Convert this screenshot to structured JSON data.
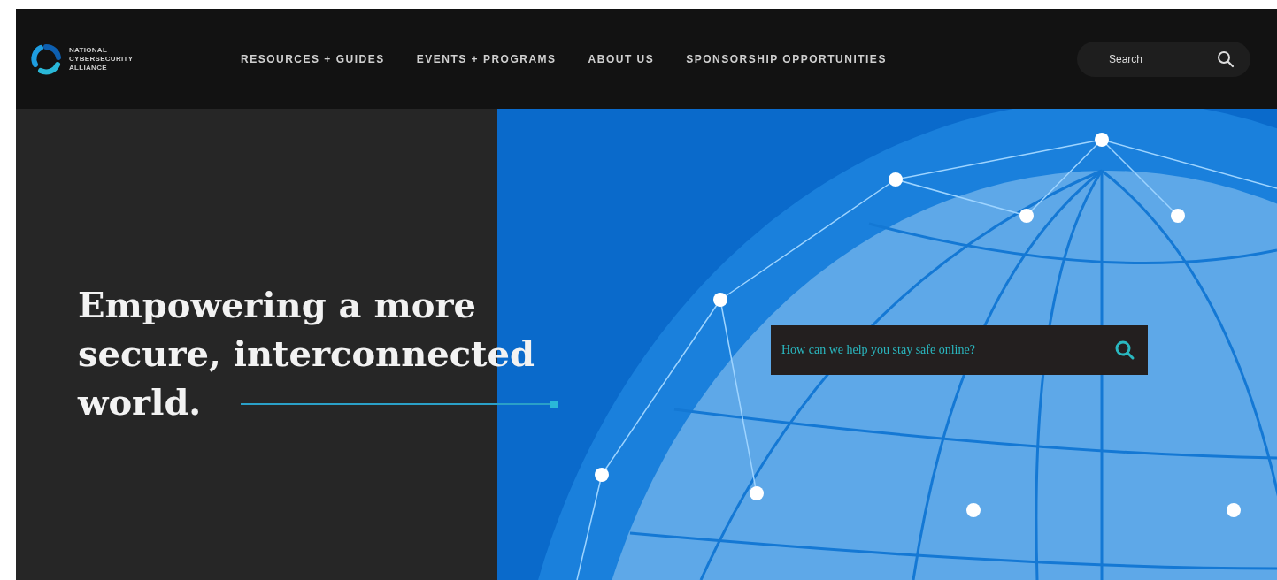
{
  "logo": {
    "lines": [
      "NATIONAL",
      "CYBERSECURITY",
      "ALLIANCE"
    ]
  },
  "nav": {
    "items": [
      {
        "label": "RESOURCES + GUIDES"
      },
      {
        "label": "EVENTS + PROGRAMS"
      },
      {
        "label": "ABOUT US"
      },
      {
        "label": "SPONSORSHIP OPPORTUNITIES"
      }
    ],
    "search": {
      "placeholder": "Search"
    }
  },
  "hero": {
    "headline": [
      "Empowering a more",
      "secure, interconnected",
      "world."
    ],
    "search": {
      "placeholder": "How can we help you stay safe online?"
    }
  }
}
